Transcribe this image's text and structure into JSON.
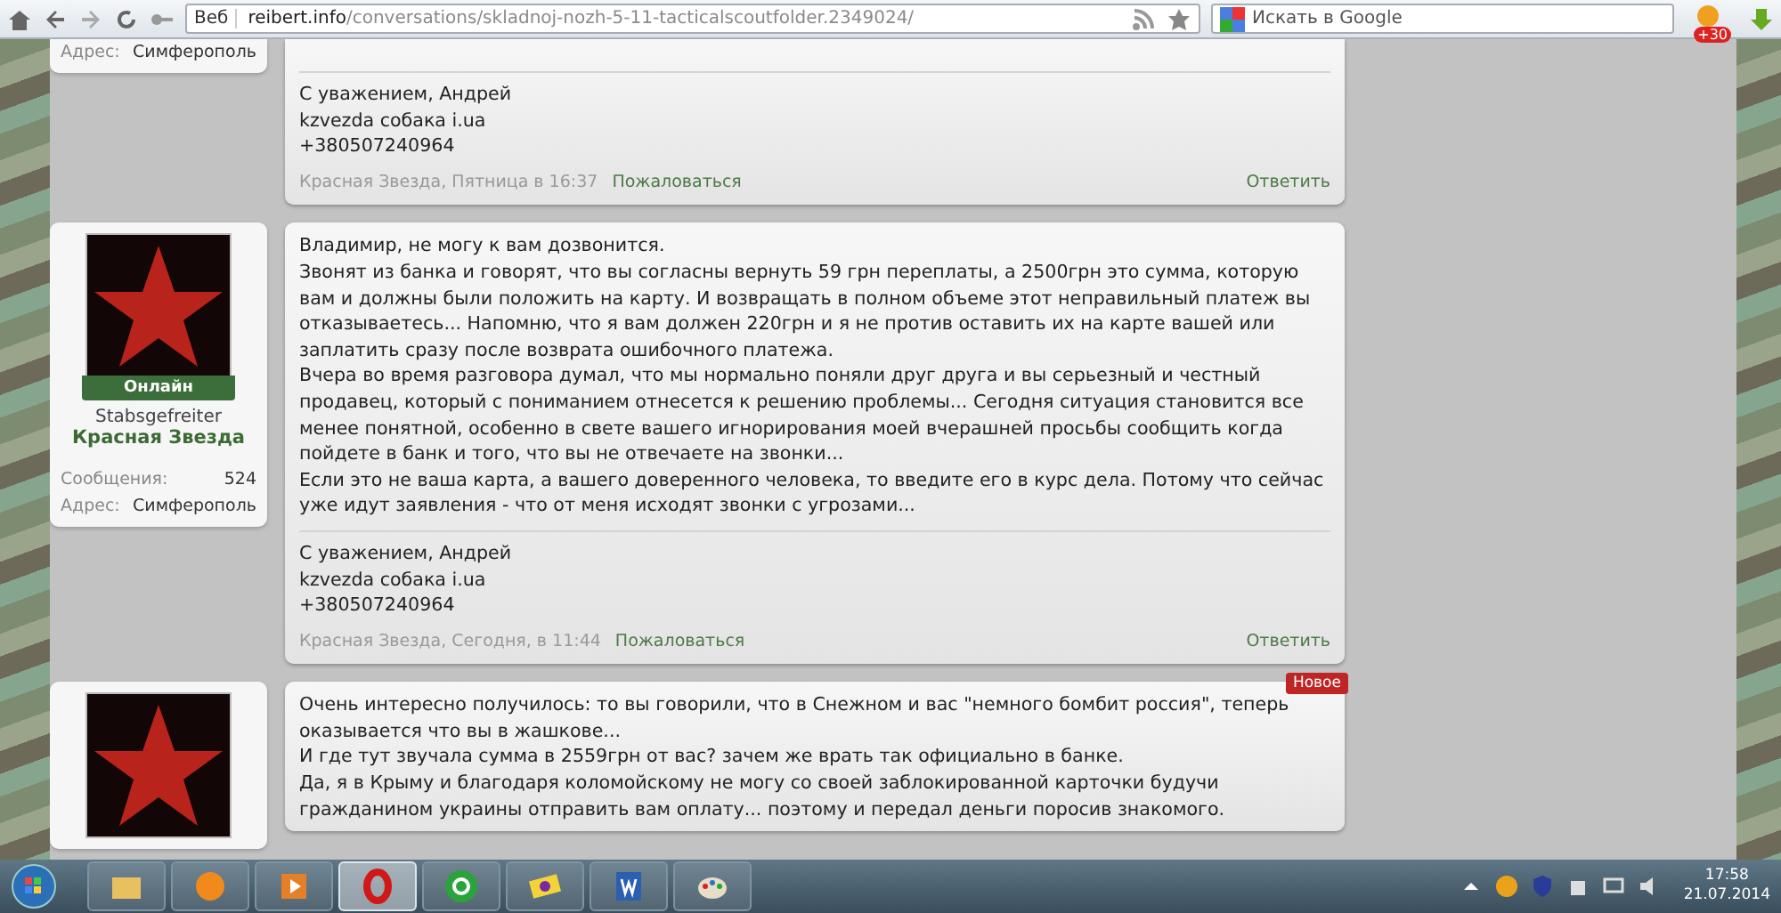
{
  "browser": {
    "tab_label": "Веб",
    "url_host": "reibert.info",
    "url_path": "/conversations/skladnoj-nozh-5-11-tacticalscoutfolder.2349024/",
    "search_placeholder": "Искать в Google",
    "badge": "+30"
  },
  "posts": [
    {
      "user": {
        "address_label": "Адрес:",
        "address": "Симферополь"
      },
      "signature": [
        "С уважением, Андрей",
        "kzvezda собака i.ua",
        "+380507240964"
      ],
      "footer": {
        "author_date": "Красная Звезда, Пятница в 16:37",
        "report": "Пожаловаться",
        "reply": "Ответить"
      }
    },
    {
      "user": {
        "avatar": true,
        "status": "Онлайн",
        "rank": "Stabsgefreiter",
        "name": "Красная Звезда",
        "messages_label": "Сообщения:",
        "messages": "524",
        "address_label": "Адрес:",
        "address": "Симферополь"
      },
      "paragraphs": [
        "Владимир, не могу к вам дозвонится.",
        "Звонят из банка и говорят, что вы согласны вернуть 59 грн переплаты, а 2500грн это сумма, которую вам и должны были положить на карту. И возвращать в полном объеме этот неправильный платеж вы отказываетесь... Напомню, что я вам должен 220грн и я не против оставить их на карте вашей или заплатить сразу после возврата ошибочного платежа.",
        "Вчера во время разговора думал, что мы нормально поняли друг друга и вы серьезный и честный продавец, который с пониманием отнесется к решению проблемы... Сегодня ситуация становится все менее понятной, особенно в свете вашего игнорирования моей вчерашней просьбы сообщить когда пойдете в банк и того, что вы не отвечаете на звонки...",
        "Если это не ваша карта, а вашего доверенного человека, то введите его в курс дела. Потому что сейчас уже идут заявления - что от меня исходят звонки с угрозами..."
      ],
      "signature": [
        "С уважением, Андрей",
        "kzvezda собака i.ua",
        "+380507240964"
      ],
      "footer": {
        "author_date": "Красная Звезда, Сегодня, в 11:44",
        "report": "Пожаловаться",
        "reply": "Ответить"
      }
    },
    {
      "user": {
        "avatar": true
      },
      "new_badge": "Новое",
      "paragraphs": [
        "Очень интересно получилось: то вы говорили, что в Снежном и вас \"немного бомбит россия\", теперь оказывается что вы в жашкове...",
        "И где тут звучала сумма в 2559грн от вас? зачем же врать так официально в банке.",
        "Да, я в Крыму и благодаря коломойскому не могу со своей заблокированной карточки будучи гражданином украины отправить вам оплату... поэтому и передал деньги поросив знакомого."
      ]
    }
  ],
  "taskbar": {
    "apps": [
      {
        "kind": "folder",
        "selected": false
      },
      {
        "kind": "orb",
        "selected": false
      },
      {
        "kind": "media",
        "selected": false
      },
      {
        "kind": "opera",
        "selected": true
      },
      {
        "kind": "mail",
        "selected": false
      },
      {
        "kind": "ticket",
        "selected": false
      },
      {
        "kind": "word",
        "selected": false
      },
      {
        "kind": "paint",
        "selected": false
      }
    ],
    "time": "17:58",
    "date": "21.07.2014"
  }
}
